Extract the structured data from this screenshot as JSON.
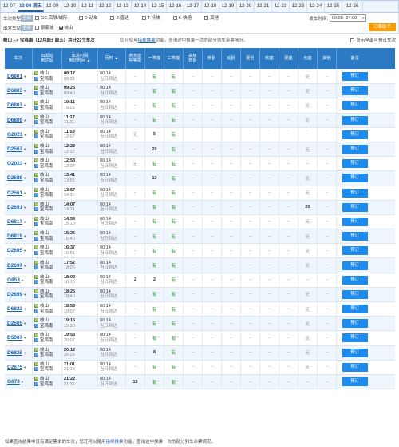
{
  "dates": [
    {
      "label": "12-07",
      "active": false
    },
    {
      "label": "12-08 周五",
      "active": true
    },
    {
      "label": "12-09",
      "active": false
    },
    {
      "label": "12-10",
      "active": false
    },
    {
      "label": "12-11",
      "active": false
    },
    {
      "label": "12-12",
      "active": false
    },
    {
      "label": "12-13",
      "active": false
    },
    {
      "label": "12-14",
      "active": false
    },
    {
      "label": "12-15",
      "active": false
    },
    {
      "label": "12-16",
      "active": false
    },
    {
      "label": "12-17",
      "active": false
    },
    {
      "label": "12-18",
      "active": false
    },
    {
      "label": "12-19",
      "active": false
    },
    {
      "label": "12-20",
      "active": false
    },
    {
      "label": "12-21",
      "active": false
    },
    {
      "label": "12-22",
      "active": false
    },
    {
      "label": "12-23",
      "active": false
    },
    {
      "label": "12-24",
      "active": false
    },
    {
      "label": "12-25",
      "active": false
    },
    {
      "label": "12-26",
      "active": false
    }
  ],
  "filters": {
    "type_label": "车次类型:",
    "all_label": "全部",
    "types": [
      {
        "label": "GC-高铁/城际",
        "checked": false
      },
      {
        "label": "D-动车",
        "checked": false
      },
      {
        "label": "Z-直达",
        "checked": false
      },
      {
        "label": "T-特快",
        "checked": false
      },
      {
        "label": "K-快速",
        "checked": false
      },
      {
        "label": "其他",
        "checked": false
      }
    ],
    "dep_station_label": "出发车站:",
    "dep_stations": [
      {
        "label": "景家坡",
        "checked": false
      },
      {
        "label": "岐山",
        "checked": true
      }
    ],
    "time_label": "发车时间:",
    "time_value": "00:00--24:00",
    "order_btn": "订票助手"
  },
  "route": {
    "title": "岐山 --> 宝鸡南（12月8日 周五）共计22个车次",
    "hint_pre": "您可使用",
    "hint_link": "接续换乘",
    "hint_post": "功能，查询途中换乘一次的部分列车余票情况。",
    "show_all": "显示全部可预订车次"
  },
  "headers": [
    "车次",
    "出发站\n到达站",
    "出发时间\n到达时间 ▲",
    "历时 ▲",
    "商务座\n特等座",
    "一等座",
    "二等座",
    "高级\n软卧",
    "软卧",
    "动卧",
    "硬卧",
    "软座",
    "硬座",
    "无座",
    "其他",
    "备注"
  ],
  "trains": [
    {
      "no": "D6801",
      "from": "岐山",
      "to": "宝鸡南",
      "dep": "08:17",
      "arr": "08:31",
      "dur": "00:14",
      "day": "当日到达",
      "seats": [
        "--",
        "有",
        "有",
        "--",
        "--",
        "--",
        "--",
        "--",
        "--",
        "无",
        "--"
      ],
      "book": "预订"
    },
    {
      "no": "D6805",
      "from": "岐山",
      "to": "宝鸡南",
      "dep": "09:26",
      "arr": "09:40",
      "dur": "00:14",
      "day": "当日到达",
      "seats": [
        "--",
        "有",
        "有",
        "--",
        "--",
        "--",
        "--",
        "--",
        "--",
        "无",
        "--"
      ],
      "book": "预订"
    },
    {
      "no": "D6807",
      "from": "岐山",
      "to": "宝鸡南",
      "dep": "10:11",
      "arr": "10:25",
      "dur": "00:14",
      "day": "当日到达",
      "seats": [
        "--",
        "有",
        "有",
        "--",
        "--",
        "--",
        "--",
        "--",
        "--",
        "无",
        "--"
      ],
      "book": "预订"
    },
    {
      "no": "D6809",
      "from": "岐山",
      "to": "宝鸡南",
      "dep": "11:17",
      "arr": "11:31",
      "dur": "00:14",
      "day": "当日到达",
      "seats": [
        "--",
        "有",
        "有",
        "--",
        "--",
        "--",
        "--",
        "--",
        "--",
        "无",
        "--"
      ],
      "book": "预订"
    },
    {
      "no": "G2021",
      "from": "岐山",
      "to": "宝鸡南",
      "dep": "11:53",
      "arr": "12:07",
      "dur": "00:14",
      "day": "当日到达",
      "seats": [
        "无",
        "5",
        "有",
        "--",
        "--",
        "--",
        "--",
        "--",
        "--",
        "--",
        "--"
      ],
      "book": "预订"
    },
    {
      "no": "D2567",
      "from": "岐山",
      "to": "宝鸡南",
      "dep": "12:23",
      "arr": "12:37",
      "dur": "00:14",
      "day": "当日到达",
      "seats": [
        "--",
        "20",
        "有",
        "--",
        "--",
        "--",
        "--",
        "--",
        "--",
        "无",
        "--"
      ],
      "book": "预订"
    },
    {
      "no": "G2023",
      "from": "岐山",
      "to": "宝鸡南",
      "dep": "12:53",
      "arr": "13:07",
      "dur": "00:14",
      "day": "当日到达",
      "seats": [
        "无",
        "有",
        "有",
        "--",
        "--",
        "--",
        "--",
        "--",
        "--",
        "--",
        "--"
      ],
      "book": "预订"
    },
    {
      "no": "D2689",
      "from": "岐山",
      "to": "宝鸡南",
      "dep": "13:41",
      "arr": "13:55",
      "dur": "00:14",
      "day": "当日到达",
      "seats": [
        "--",
        "13",
        "有",
        "--",
        "--",
        "--",
        "--",
        "--",
        "--",
        "无",
        "--"
      ],
      "book": "预订"
    },
    {
      "no": "D2561",
      "from": "岐山",
      "to": "宝鸡南",
      "dep": "13:57",
      "arr": "14:11",
      "dur": "00:14",
      "day": "当日到达",
      "seats": [
        "--",
        "有",
        "有",
        "--",
        "--",
        "--",
        "--",
        "--",
        "--",
        "无",
        "--"
      ],
      "book": "预订"
    },
    {
      "no": "D2691",
      "from": "岐山",
      "to": "宝鸡南",
      "dep": "14:07",
      "arr": "14:21",
      "dur": "00:14",
      "day": "当日到达",
      "seats": [
        "--",
        "有",
        "有",
        "--",
        "--",
        "--",
        "--",
        "--",
        "--",
        "20",
        "--"
      ],
      "book": "预订"
    },
    {
      "no": "D6817",
      "from": "岐山",
      "to": "宝鸡南",
      "dep": "14:56",
      "arr": "15:10",
      "dur": "00:14",
      "day": "当日到达",
      "seats": [
        "--",
        "有",
        "有",
        "--",
        "--",
        "--",
        "--",
        "--",
        "--",
        "无",
        "--"
      ],
      "book": "预订"
    },
    {
      "no": "D6819",
      "from": "岐山",
      "to": "宝鸡南",
      "dep": "15:26",
      "arr": "15:40",
      "dur": "00:14",
      "day": "当日到达",
      "seats": [
        "--",
        "有",
        "有",
        "--",
        "--",
        "--",
        "--",
        "--",
        "--",
        "无",
        "--"
      ],
      "book": "预订"
    },
    {
      "no": "D2695",
      "from": "岐山",
      "to": "宝鸡南",
      "dep": "16:37",
      "arr": "16:51",
      "dur": "00:14",
      "day": "当日到达",
      "seats": [
        "--",
        "有",
        "有",
        "--",
        "--",
        "--",
        "--",
        "--",
        "--",
        "无",
        "--"
      ],
      "book": "预订"
    },
    {
      "no": "D2697",
      "from": "岐山",
      "to": "宝鸡南",
      "dep": "17:52",
      "arr": "18:06",
      "dur": "00:14",
      "day": "当日到达",
      "seats": [
        "--",
        "有",
        "有",
        "--",
        "--",
        "--",
        "--",
        "--",
        "--",
        "无",
        "--"
      ],
      "book": "预订"
    },
    {
      "no": "G853",
      "from": "岐山",
      "to": "宝鸡南",
      "dep": "18:02",
      "arr": "18:16",
      "dur": "00:14",
      "day": "当日到达",
      "seats": [
        "2",
        "2",
        "有",
        "--",
        "--",
        "--",
        "--",
        "--",
        "--",
        "--",
        "--"
      ],
      "book": "预订"
    },
    {
      "no": "D2699",
      "from": "岐山",
      "to": "宝鸡南",
      "dep": "18:26",
      "arr": "18:40",
      "dur": "00:14",
      "day": "当日到达",
      "seats": [
        "--",
        "有",
        "有",
        "--",
        "--",
        "--",
        "--",
        "--",
        "--",
        "无",
        "--"
      ],
      "book": "预订"
    },
    {
      "no": "D6823",
      "from": "岐山",
      "to": "宝鸡南",
      "dep": "18:53",
      "arr": "19:07",
      "dur": "00:14",
      "day": "当日到达",
      "seats": [
        "--",
        "有",
        "有",
        "--",
        "--",
        "--",
        "--",
        "--",
        "--",
        "无",
        "--"
      ],
      "book": "预订"
    },
    {
      "no": "D2565",
      "from": "岐山",
      "to": "宝鸡南",
      "dep": "19:16",
      "arr": "19:30",
      "dur": "00:14",
      "day": "当日到达",
      "seats": [
        "--",
        "有",
        "有",
        "--",
        "--",
        "--",
        "--",
        "--",
        "--",
        "无",
        "--"
      ],
      "book": "预订"
    },
    {
      "no": "D5087",
      "from": "岐山",
      "to": "宝鸡南",
      "dep": "19:53",
      "arr": "20:07",
      "dur": "00:14",
      "day": "当日到达",
      "seats": [
        "--",
        "有",
        "有",
        "--",
        "--",
        "--",
        "--",
        "--",
        "--",
        "无",
        "--"
      ],
      "book": "预订"
    },
    {
      "no": "D6825",
      "from": "岐山",
      "to": "宝鸡南",
      "dep": "20:12",
      "arr": "20:26",
      "dur": "00:14",
      "day": "当日到达",
      "seats": [
        "--",
        "8",
        "有",
        "--",
        "--",
        "--",
        "--",
        "--",
        "--",
        "无",
        "--"
      ],
      "book": "预订"
    },
    {
      "no": "D2675",
      "from": "岐山",
      "to": "宝鸡南",
      "dep": "21:01",
      "arr": "21:15",
      "dur": "00:14",
      "day": "当日到达",
      "seats": [
        "--",
        "有",
        "有",
        "--",
        "--",
        "--",
        "--",
        "--",
        "--",
        "无",
        "--"
      ],
      "book": "预订"
    },
    {
      "no": "G673",
      "from": "岐山",
      "to": "宝鸡南",
      "dep": "21:22",
      "arr": "21:36",
      "dur": "00:14",
      "day": "当日到达",
      "seats": [
        "13",
        "有",
        "有",
        "--",
        "--",
        "--",
        "--",
        "--",
        "--",
        "--",
        "--"
      ],
      "book": "预订"
    }
  ],
  "footer": {
    "pre": "如果查询结果中没有满足需求的车次，您还可以使用",
    "link": "接续换乘",
    "post": "功能，查询途中换乘一次的部分列车余票情况。"
  },
  "colors": {
    "header_bg": "#2c7ac3",
    "book_btn": "#1d8cf0",
    "order_btn": "#ff9900",
    "available": "#2a9d2a"
  }
}
